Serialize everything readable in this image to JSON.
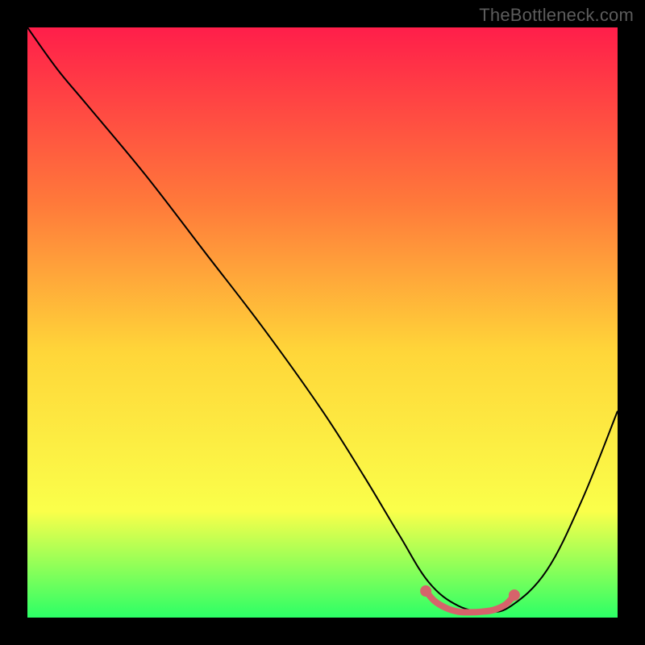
{
  "watermark": "TheBottleneck.com",
  "chart_data": {
    "type": "line",
    "title": "",
    "xlabel": "",
    "ylabel": "",
    "xlim": [
      0,
      100
    ],
    "ylim": [
      0,
      100
    ],
    "grid": false,
    "legend": false,
    "background_gradient": {
      "top_color": "#ff1e4a",
      "mid_color_1": "#ff7a3a",
      "mid_color_2": "#ffd639",
      "mid_color_3": "#faff4a",
      "bottom_color": "#2cff66"
    },
    "series": [
      {
        "name": "bottleneck-curve",
        "x": [
          0,
          5,
          10,
          20,
          30,
          40,
          50,
          57,
          63,
          68,
          73,
          78,
          82,
          88,
          94,
          100
        ],
        "values": [
          100,
          93,
          87,
          75,
          62,
          49,
          35,
          24,
          14,
          6,
          2,
          1,
          2,
          8,
          20,
          35
        ],
        "stroke": "#000000",
        "stroke_width": 2
      },
      {
        "name": "optimal-range-highlight",
        "x": [
          67.5,
          69,
          71,
          73,
          75,
          77,
          79,
          81,
          82.5
        ],
        "values": [
          4.5,
          2.8,
          1.6,
          1.0,
          0.9,
          1.0,
          1.3,
          2.2,
          3.8
        ],
        "stroke": "#d6636b",
        "stroke_width": 8,
        "endpoint_markers": true
      }
    ]
  }
}
